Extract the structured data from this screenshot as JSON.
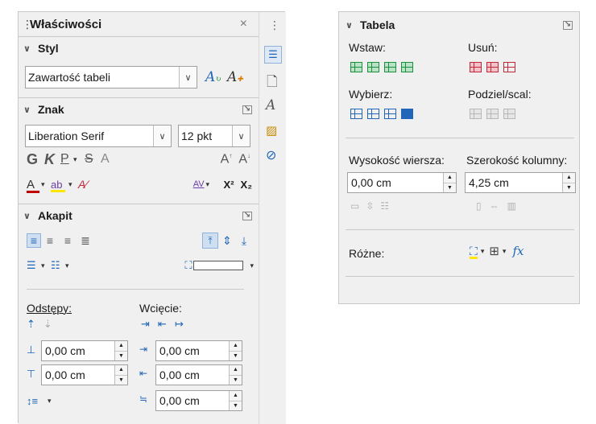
{
  "left_panel": {
    "title": "Właściwości",
    "close_glyph": "×",
    "menu_glyph": "⋮",
    "styl": {
      "header": "Styl",
      "paragraph_style_value": "Zawartość tabeli"
    },
    "znak": {
      "header": "Znak",
      "font_name": "Liberation Serif",
      "font_size": "12 pkt",
      "bold": "G",
      "italic": "K",
      "underline": "P",
      "strike": "S",
      "shadow": "A",
      "grow": "A",
      "shrink": "A",
      "font_color": "A",
      "spacing": "AV",
      "superscript": "X²",
      "subscript": "X₂"
    },
    "akapit": {
      "header": "Akapit",
      "odstepy_label": "Odstępy:",
      "wciecie_label": "Wcięcie:",
      "above_spacing": "0,00 cm",
      "below_spacing": "0,00 cm",
      "before_indent": "0,00 cm",
      "after_indent": "0,00 cm",
      "first_line_indent": "0,00 cm"
    }
  },
  "right_panel": {
    "header": "Tabela",
    "wstaw_label": "Wstaw:",
    "usun_label": "Usuń:",
    "wybierz_label": "Wybierz:",
    "podziel_label": "Podziel/scal:",
    "row_height_label": "Wysokość wiersza:",
    "col_width_label": "Szerokość kolumny:",
    "row_height_value": "0,00 cm",
    "col_width_value": "4,25 cm",
    "rozne_label": "Różne:",
    "fx": "fx"
  },
  "colors": {
    "panel_bg": "#f0f0f0",
    "accent_blue": "#2166b8",
    "insert_green": "#1a8f3c",
    "delete_red": "#c0283a",
    "font_color_red": "#c00000",
    "highlight_yellow": "#ffe600"
  }
}
